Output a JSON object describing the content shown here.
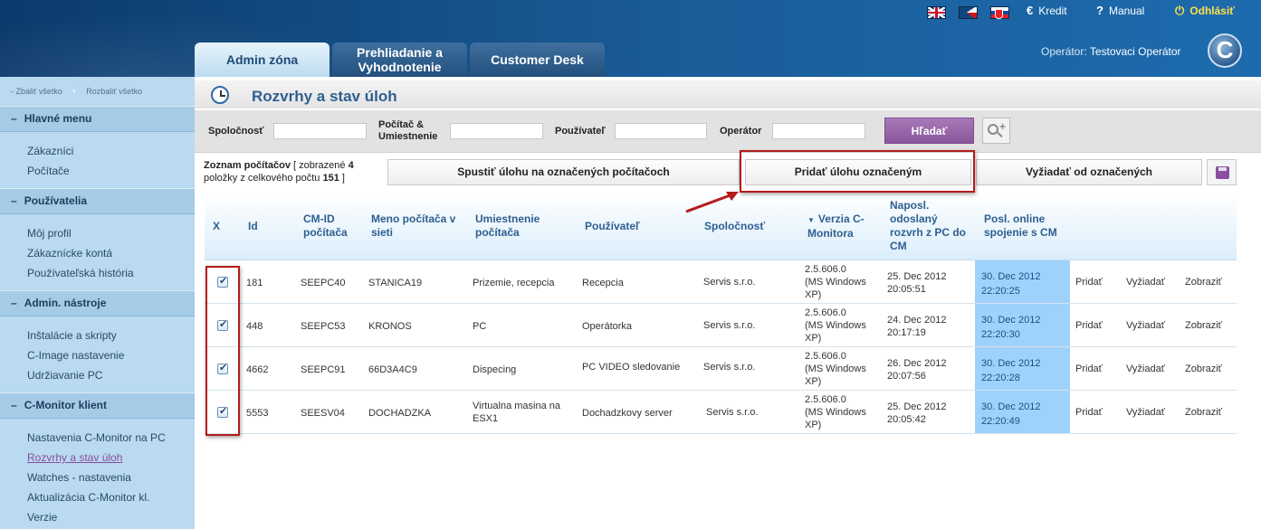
{
  "header": {
    "flags": [
      "english-flag-icon",
      "czech-flag-icon",
      "slovak-flag-icon"
    ],
    "links": {
      "kredit": "Kredit",
      "kredit_icon": "€",
      "manual": "Manual",
      "manual_icon": "?",
      "logout": "Odhlásiť",
      "logout_icon": "⏻"
    },
    "tabs": [
      "Admin zóna",
      "Prehliadanie a Vyhodnotenie",
      "Customer Desk"
    ],
    "operator_label": "Operátor:",
    "operator_name": "Testovaci Operátor",
    "logo_letter": "C",
    "colors": {
      "header": "#1a5d99",
      "sidebar": "#b9daf0",
      "accent": "#8a569c",
      "online": "#9fd2fb",
      "highlight": "#b31b1b"
    }
  },
  "sidebar": {
    "collapse_all": "- Zbaliť všetko",
    "expand_all": "Rozbaliť všetko",
    "sections": [
      {
        "title": "Hlavné menu",
        "items": [
          "Zákazníci",
          "Počítače"
        ]
      },
      {
        "title": "Používatelia",
        "items": [
          "Môj profil",
          "Zákaznícke kontá",
          "Používateľská história"
        ]
      },
      {
        "title": "Admin. nástroje",
        "items": [
          "Inštalácie a skripty",
          "C-Image nastavenie",
          "Udržiavanie PC"
        ]
      },
      {
        "title": "C-Monitor klient",
        "items": [
          "Nastavenia C-Monitor na PC",
          "Rozvrhy a stav úloh",
          "Watches - nastavenia",
          "Aktualizácia C-Monitor kl.",
          "Verzie"
        ]
      }
    ],
    "section_dash": "–"
  },
  "page": {
    "title": "Rozvrhy a stav úloh"
  },
  "filters": {
    "company_label": "Spoločnosť",
    "computer_label_1": "Počítač &",
    "computer_label_2": "Umiestnenie",
    "user_label": "Používateľ",
    "operator_label": "Operátor",
    "search_button": "Hľadať",
    "company_value": "",
    "computer_value": "",
    "user_value": "",
    "operator_value": ""
  },
  "list": {
    "info_1": "Zoznam počítačov",
    "info_2": "[ zobrazené",
    "shown": "4",
    "info_3": "položky z celkového počtu",
    "total": "151",
    "info_4": "]"
  },
  "actions": {
    "run_task": "Spustiť úlohu na označených počítačoch",
    "add_task": "Pridať úlohu označeným",
    "request": "Vyžiadať od označených"
  },
  "table": {
    "headers": {
      "x": "X",
      "id": "Id",
      "cmid_1": "CM-ID",
      "cmid_2": "počítača",
      "name_1": "Meno počítača v",
      "name_2": "sieti",
      "loc_1": "Umiestnenie",
      "loc_2": "počítača",
      "user": "Používateľ",
      "company": "Spoločnosť",
      "ver_1": "Verzia C-",
      "ver_2": "Monitora",
      "sched_1": "Naposl.",
      "sched_2": "odoslaný",
      "sched_3": "rozvrh z PC do",
      "sched_4": "CM",
      "online_1": "Posl. online",
      "online_2": "spojenie s CM",
      "sort_icon": "▼"
    },
    "rows": [
      {
        "id": "181",
        "cmid": "SEEPC40",
        "name": "STANICA19",
        "loc_1": "Prizemie, recepcia",
        "loc_2": "",
        "user": "Recepcia",
        "company": "Servis  s.r.o.",
        "ver_1": "2.5.606.0",
        "ver_2": "(MS Windows",
        "ver_3": "XP)",
        "sched_1": "25. Dec 2012",
        "sched_2": "20:05:51",
        "online_1": "30. Dec 2012",
        "online_2": "22:20:25",
        "add": "Pridať",
        "req": "Vyžiadať",
        "show": "Zobraziť"
      },
      {
        "id": "448",
        "cmid": "SEEPC53",
        "name": "KRONOS",
        "loc_1": "PC",
        "loc_2": "",
        "user": "Operátorka",
        "company": "Servis  s.r.o.",
        "ver_1": "2.5.606.0",
        "ver_2": "(MS Windows",
        "ver_3": "XP)",
        "sched_1": "24. Dec 2012",
        "sched_2": "20:17:19",
        "online_1": "30. Dec 2012",
        "online_2": "22:20:30",
        "add": "Pridať",
        "req": "Vyžiadať",
        "show": "Zobraziť"
      },
      {
        "id": "4662",
        "cmid": "SEEPC91",
        "name": "66D3A4C9",
        "loc_1": "Dispecing",
        "loc_2": "",
        "user": "PC VIDEO sledovanie",
        "company": "Servis  s.r.o.",
        "ver_1": "2.5.606.0",
        "ver_2": "(MS Windows",
        "ver_3": "XP)",
        "sched_1": "26. Dec 2012",
        "sched_2": "20:07:56",
        "online_1": "30. Dec 2012",
        "online_2": "22:20:28",
        "add": "Pridať",
        "req": "Vyžiadať",
        "show": "Zobraziť"
      },
      {
        "id": "5553",
        "cmid": "SEESV04",
        "name": "DOCHADZKA",
        "loc_1": "Virtualna masina na",
        "loc_2": "ESX1",
        "user": "Dochadzkovy server",
        "company": "Servis  s.r.o.",
        "ver_1": "2.5.606.0",
        "ver_2": "(MS Windows",
        "ver_3": "XP)",
        "sched_1": "25. Dec 2012",
        "sched_2": "20:05:42",
        "online_1": "30. Dec 2012",
        "online_2": "22:20:49",
        "add": "Pridať",
        "req": "Vyžiadať",
        "show": "Zobraziť"
      }
    ]
  }
}
